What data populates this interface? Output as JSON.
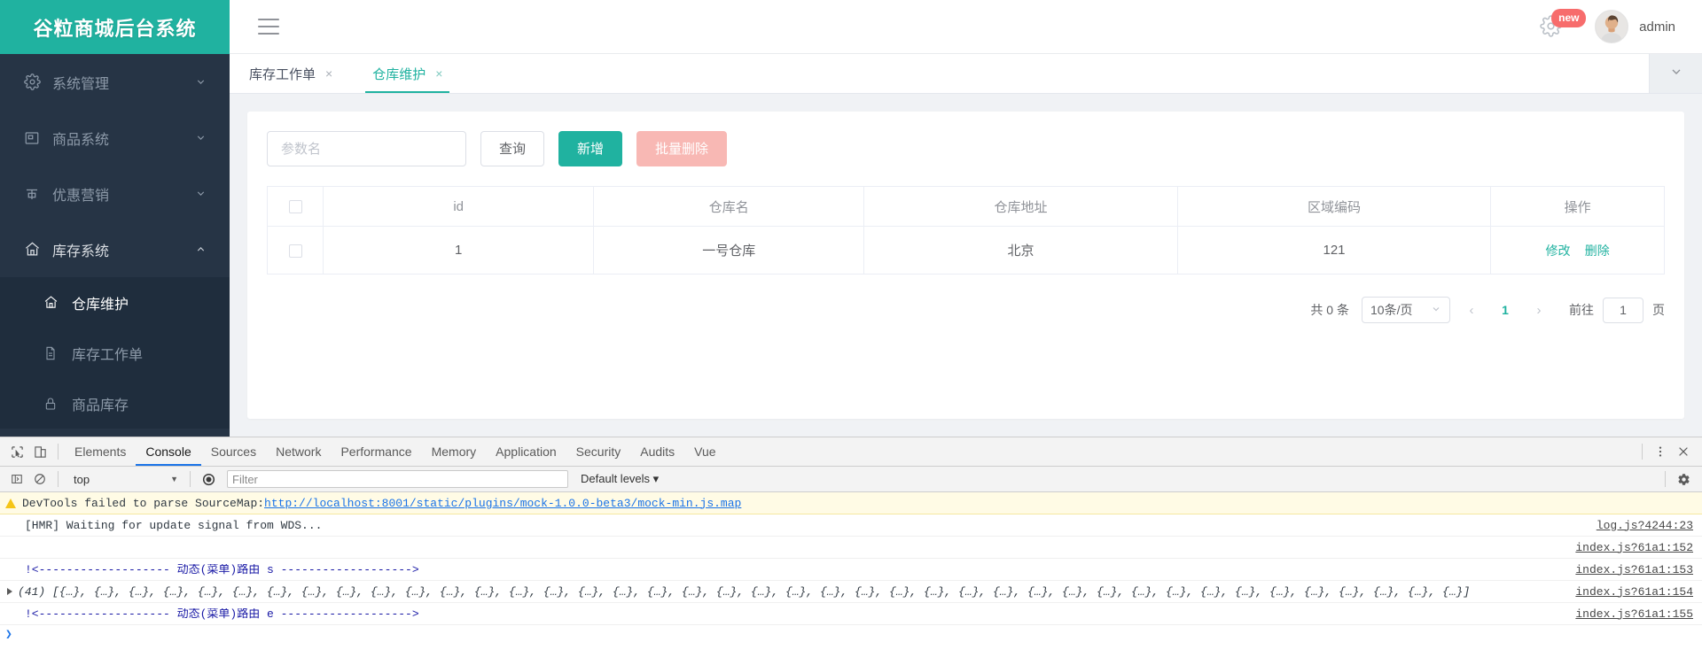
{
  "app": {
    "logo_title": "谷粒商城后台系统",
    "accent_color": "#20b2a0",
    "sidebar_bg": "#263445"
  },
  "sidebar": {
    "groups": [
      {
        "label": "系统管理",
        "icon": "gear-icon",
        "open": false
      },
      {
        "label": "商品系统",
        "icon": "picture-icon",
        "open": false
      },
      {
        "label": "优惠营销",
        "icon": "coupon-icon",
        "open": false
      },
      {
        "label": "库存系统",
        "icon": "home-icon",
        "open": true
      }
    ],
    "stock_items": [
      {
        "label": "仓库维护",
        "icon": "home-icon",
        "active": true
      },
      {
        "label": "库存工作单",
        "icon": "document-icon",
        "active": false
      },
      {
        "label": "商品库存",
        "icon": "lock-icon",
        "active": false
      }
    ]
  },
  "navbar": {
    "hamburger": "hamburger-icon",
    "gear": "gear-icon",
    "badge": "new",
    "username": "admin"
  },
  "tabs": {
    "items": [
      {
        "label": "库存工作单",
        "close": "×",
        "active": false
      },
      {
        "label": "仓库维护",
        "close": "×",
        "active": true
      }
    ],
    "collapse_icon": "chevron-down-icon"
  },
  "toolbar": {
    "search_placeholder": "参数名",
    "search_value": "",
    "query_label": "查询",
    "add_label": "新增",
    "batch_delete_label": "批量删除"
  },
  "table": {
    "columns": [
      "",
      "id",
      "仓库名",
      "仓库地址",
      "区域编码",
      "操作"
    ],
    "rows": [
      {
        "id": "1",
        "name": "一号仓库",
        "address": "北京",
        "areacode": "121",
        "edit_label": "修改",
        "delete_label": "删除"
      }
    ]
  },
  "pagination": {
    "total_text": "共 0 条",
    "page_size": "10条/页",
    "prev": "‹",
    "current_page": "1",
    "next": "›",
    "jump_label": "前往",
    "jump_value": "1",
    "jump_unit": "页"
  },
  "devtools": {
    "tabs": [
      "Elements",
      "Console",
      "Sources",
      "Network",
      "Performance",
      "Memory",
      "Application",
      "Security",
      "Audits",
      "Vue"
    ],
    "active_tab": "Console",
    "context": "top",
    "filter_placeholder": "Filter",
    "filter_value": "",
    "levels_label": "Default levels",
    "console_rows": [
      {
        "kind": "warning",
        "text": "DevTools failed to parse SourceMap: ",
        "link": "http://localhost:8001/static/plugins/mock-1.0.0-beta3/mock-min.js.map",
        "source": ""
      },
      {
        "kind": "log",
        "text": "[HMR] Waiting for update signal from WDS...",
        "link": "",
        "source": "log.js?4244:23"
      },
      {
        "kind": "blank",
        "text": "",
        "link": "",
        "source": "index.js?61a1:152"
      },
      {
        "kind": "blue",
        "text": "!<------------------- 动态(菜单)路由 s ------------------->",
        "link": "",
        "source": "index.js?61a1:153"
      },
      {
        "kind": "array",
        "text": "(41) [{…}, {…}, {…}, {…}, {…}, {…}, {…}, {…}, {…}, {…}, {…}, {…}, {…}, {…}, {…}, {…}, {…}, {…}, {…}, {…}, {…}, {…}, {…}, {…}, {…}, {…}, {…}, {…}, {…}, {…}, {…}, {…}, {…}, {…}, {…}, {…}, {…}, {…}, {…}, {…}, {…}]",
        "link": "",
        "source": "index.js?61a1:154"
      },
      {
        "kind": "blue",
        "text": "!<------------------- 动态(菜单)路由 e ------------------->",
        "link": "",
        "source": "index.js?61a1:155"
      }
    ]
  }
}
